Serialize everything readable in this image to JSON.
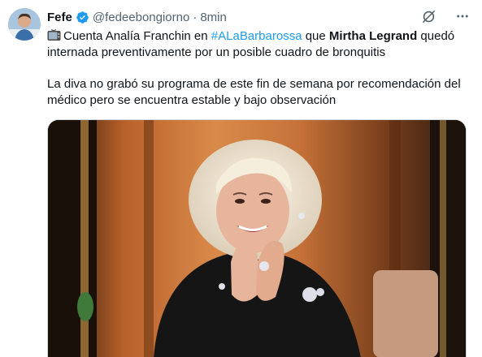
{
  "author": {
    "name": "Fefe",
    "handle": "@fedeebongiorno",
    "separator": "·",
    "time": "8min"
  },
  "tweet": {
    "line1_pre": "Cuenta Analía Franchin en ",
    "hashtag": "#ALaBarbarossa",
    "line1_mid": " que ",
    "bold_name": "Mirtha Legrand",
    "line1_post": " quedó",
    "line2": "internada preventivamente por un posible cuadro de bronquitis",
    "line3": "La diva no grabó su programa de este fin de semana por recomendación del",
    "line4": "médico pero se encuentra estable y bajo observación"
  },
  "icons": {
    "verified": "verified-badge-icon",
    "tv": "television-emoji-icon",
    "grok": "grok-icon",
    "more": "more-options-icon"
  },
  "colors": {
    "accent": "#1d9bf0",
    "text": "#0f1419",
    "secondary": "#536471"
  }
}
